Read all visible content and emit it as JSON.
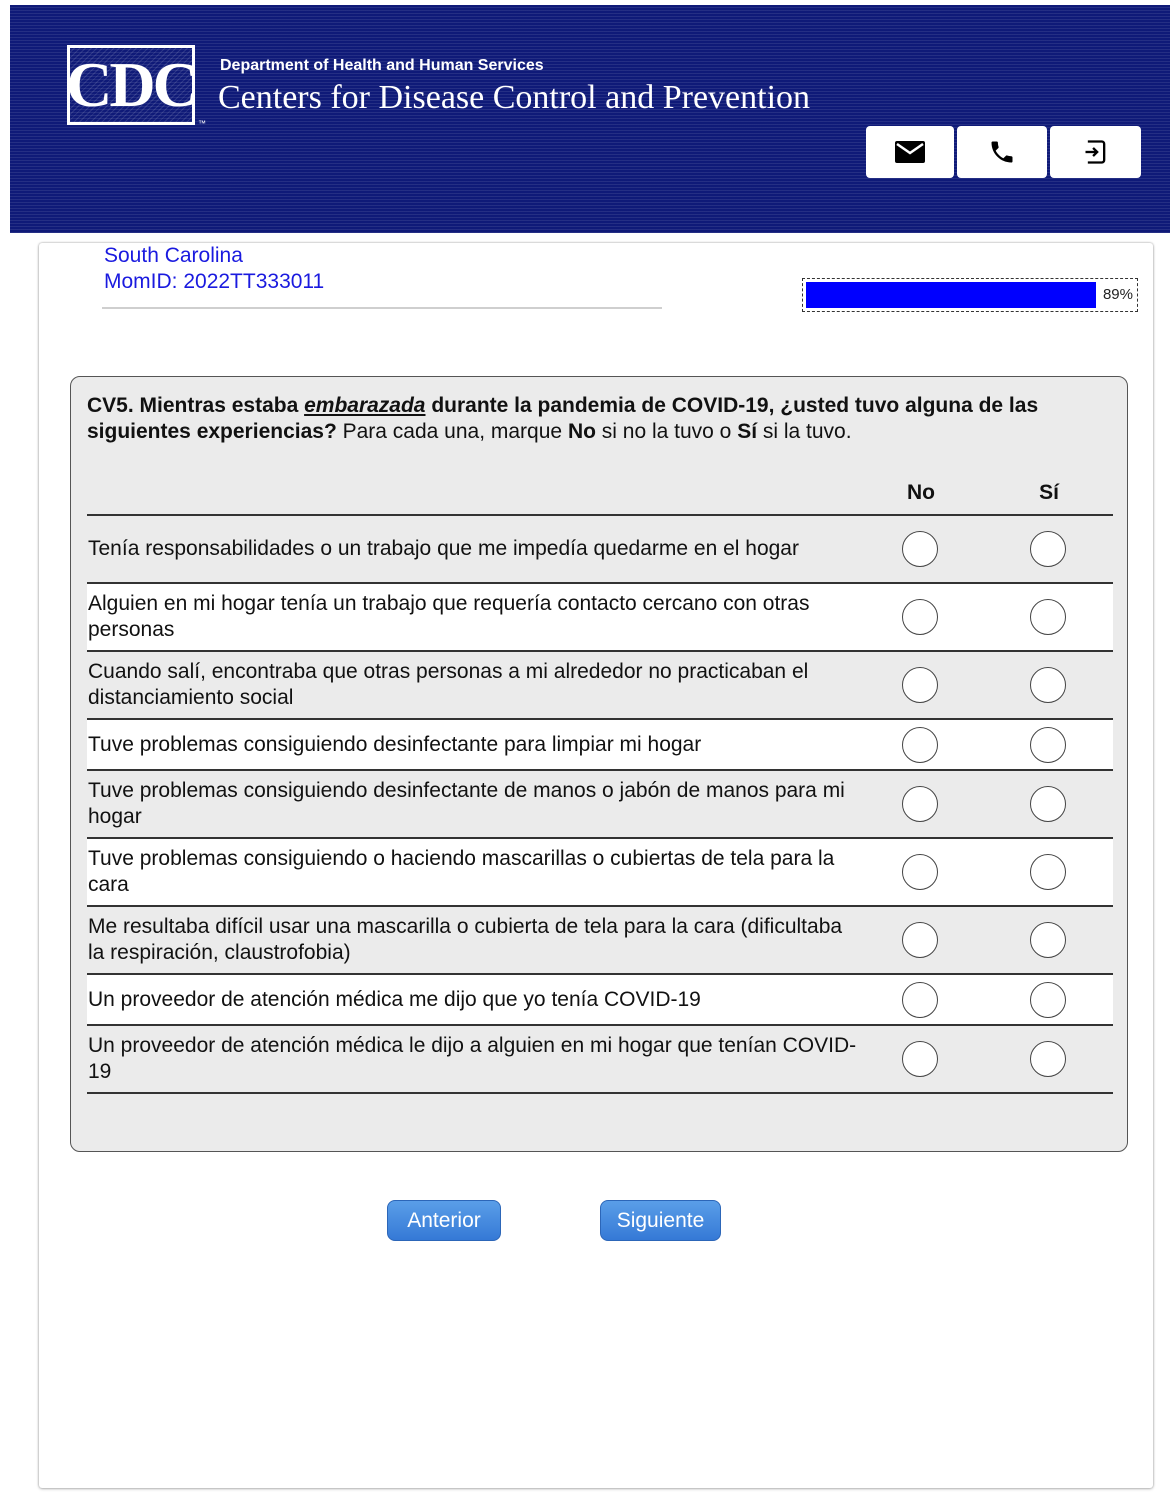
{
  "header": {
    "logo_text": "CDC",
    "logo_tm": "™",
    "department": "Department of Health and Human Services",
    "agency": "Centers for Disease Control and Prevention",
    "buttons": [
      {
        "icon": "mail-icon"
      },
      {
        "icon": "phone-icon"
      },
      {
        "icon": "logout-icon"
      }
    ]
  },
  "respondent": {
    "state": "South Carolina",
    "mom_id": "MomID: 2022TT333011"
  },
  "progress": {
    "value_percent": 89,
    "label": "89%"
  },
  "question": {
    "id_bold": "CV5. Mientras estaba ",
    "emphasis": "embarazada",
    "bold_rest": " durante la pandemia de COVID-19, ¿usted tuvo alguna de las siguientes experiencias?",
    "instr_1": " Para cada una, marque ",
    "no_word": "No",
    "instr_2": " si no la tuvo o ",
    "si_word": "Sí",
    "instr_3": " si la tuvo.",
    "col_no": "No",
    "col_si": "Sí",
    "items": [
      "Tenía responsabilidades o un trabajo que me impedía quedarme en el hogar",
      "Alguien en mi hogar tenía un trabajo que requería contacto cercano con otras personas",
      "Cuando salí, encontraba que otras personas a mi alrededor no practicaban el distanciamiento social",
      "Tuve problemas consiguiendo desinfectante para limpiar mi hogar",
      "Tuve problemas consiguiendo desinfectante de manos o jabón de manos para mi hogar",
      "Tuve problemas consiguiendo o haciendo mascarillas o cubiertas de tela para la cara",
      "Me resultaba difícil usar una mascarilla o cubierta de tela para la cara (dificultaba la respiración, claustrofobia)",
      "Un proveedor de atención médica me dijo que yo tenía COVID-19",
      "Un proveedor de atención médica le dijo a alguien en mi hogar que tenían COVID-19"
    ]
  },
  "nav": {
    "prev_label": "Anterior",
    "next_label": "Siguiente"
  },
  "colors": {
    "header_bg": "#0f1a78",
    "link_blue": "#1a1adf",
    "progress_fill": "#0000ff",
    "button_blue": "#3d82dc"
  }
}
